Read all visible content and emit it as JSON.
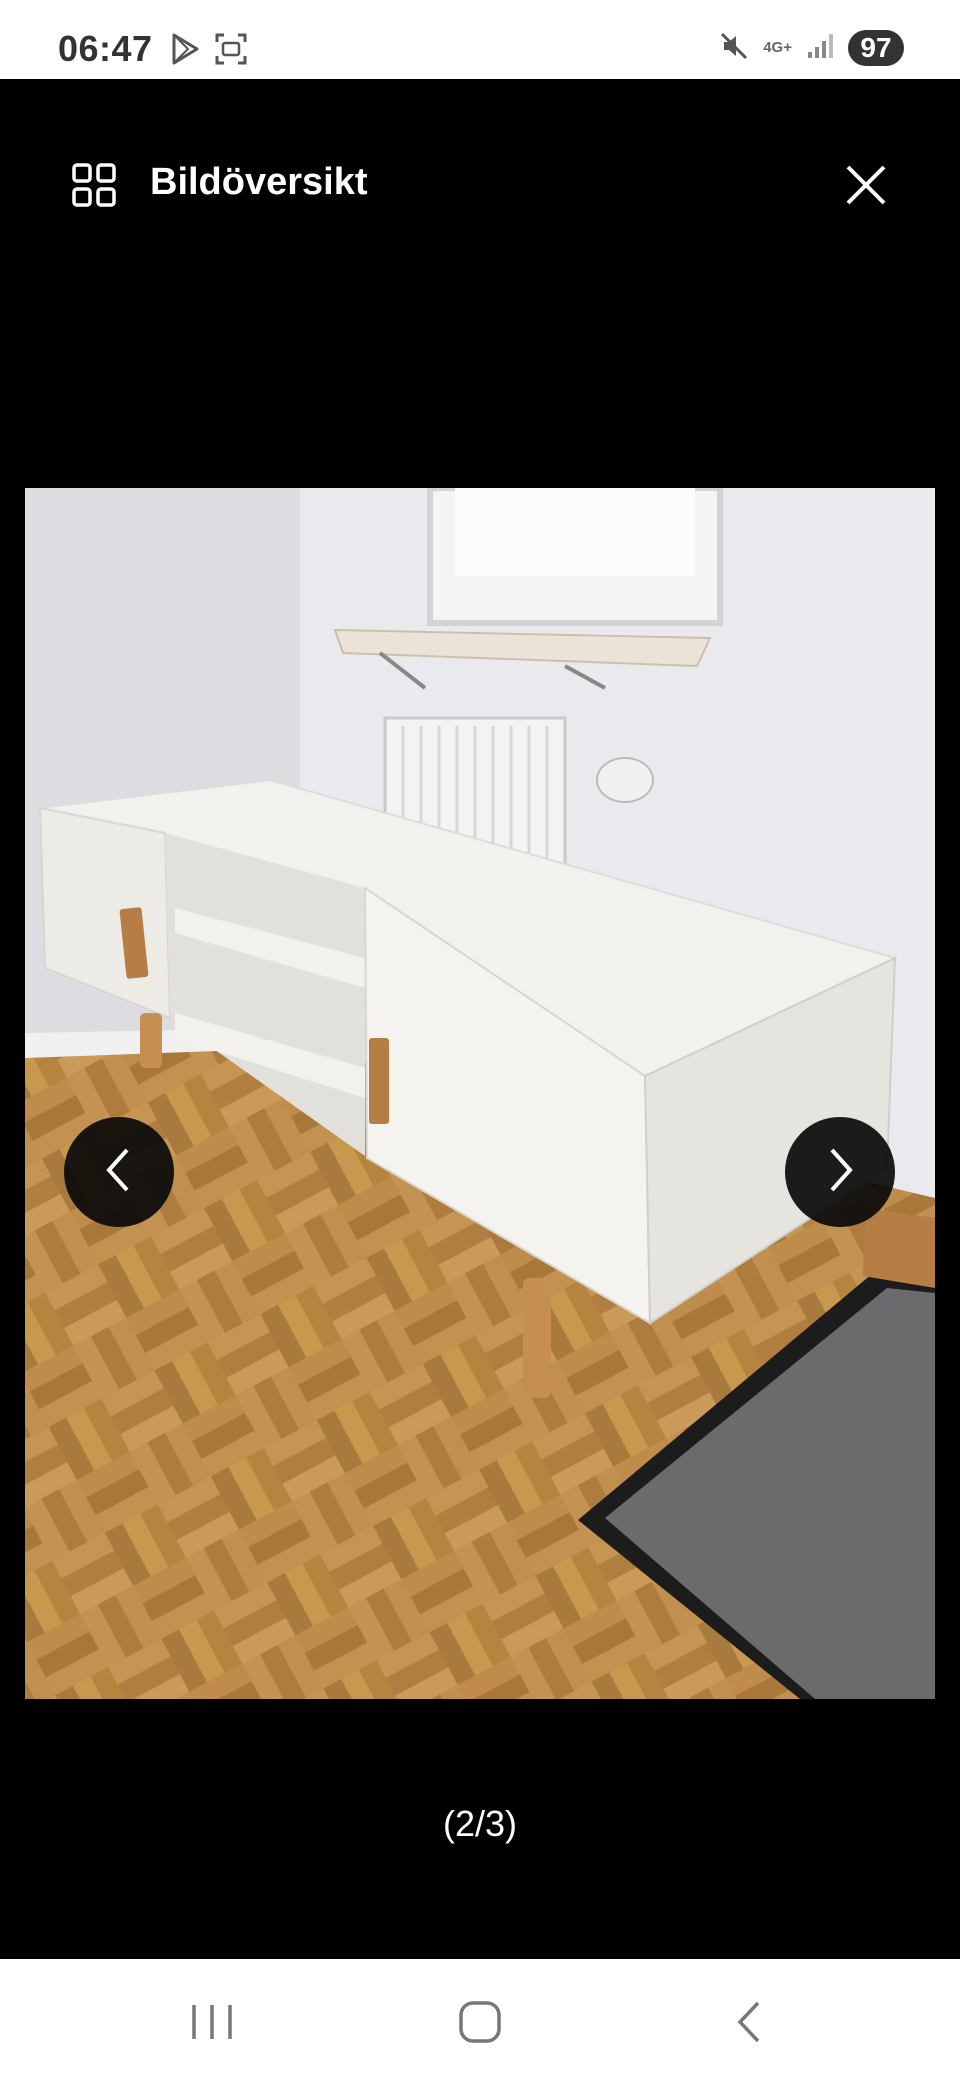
{
  "status_bar": {
    "time": "06:47",
    "left_icons": [
      "play-store-icon",
      "screenshot-icon"
    ],
    "network": "4G+",
    "battery": "97",
    "right_icons": [
      "mute-icon",
      "signal-icon"
    ]
  },
  "viewer": {
    "title": "Bildöversikt",
    "grid_icon": "grid-icon",
    "close_icon": "close-icon",
    "prev_icon": "chevron-left-icon",
    "next_icon": "chevron-right-icon",
    "counter": "(2/3)"
  },
  "nav_bar": {
    "buttons": [
      "recent-apps-icon",
      "home-icon",
      "back-icon"
    ]
  },
  "colors": {
    "background": "#000000",
    "text": "#ffffff",
    "status_bar": "#ffffff",
    "nav_button_fill": "#0a0a0a"
  }
}
